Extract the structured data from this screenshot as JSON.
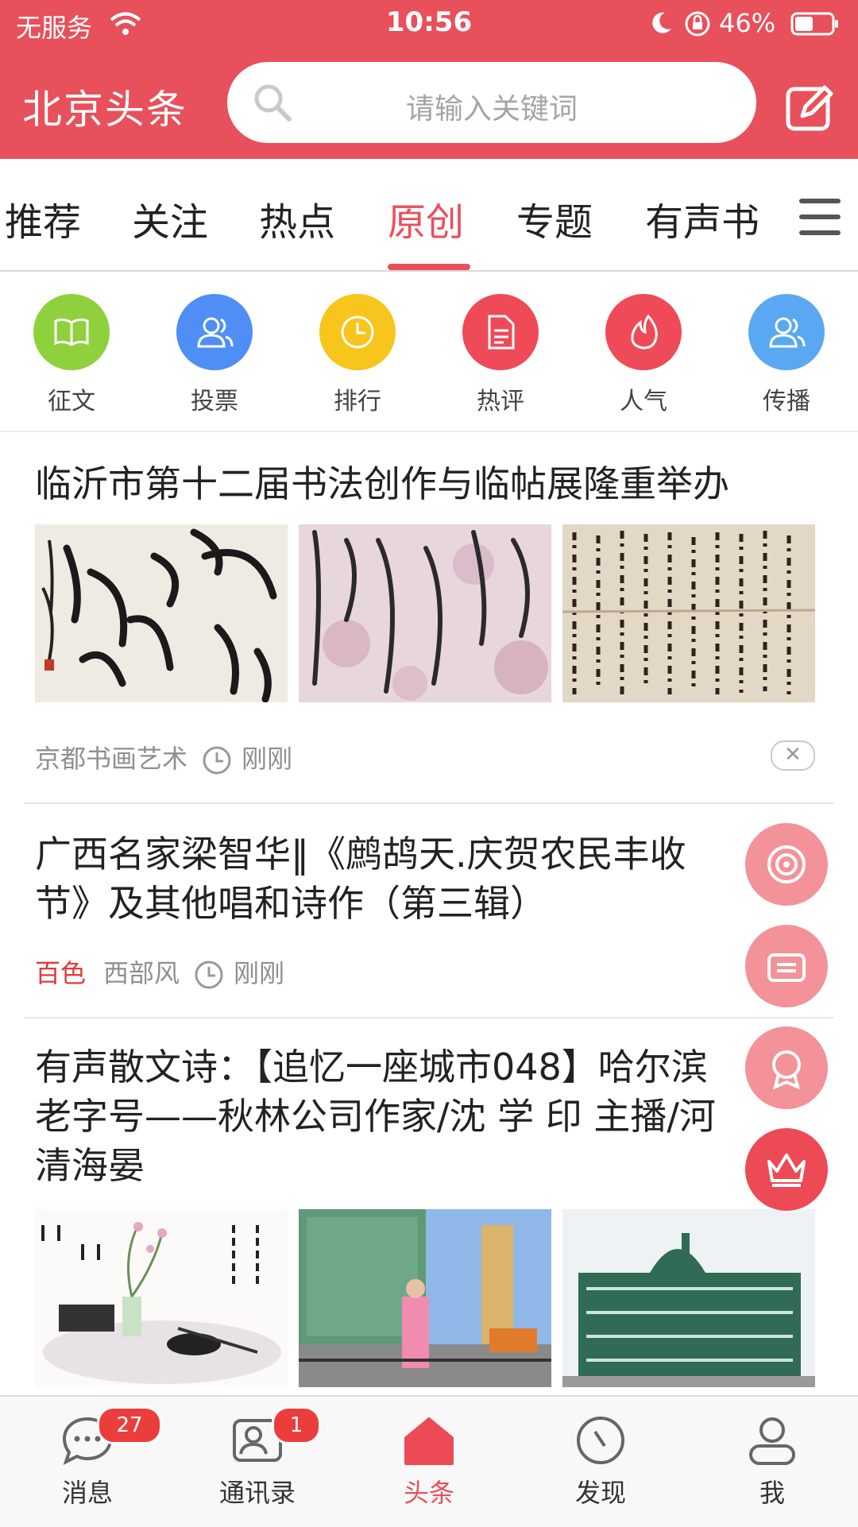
{
  "status_bar": {
    "carrier": "无服务",
    "time": "10:56",
    "battery": "46%"
  },
  "header": {
    "title": "北京头条",
    "search_placeholder": "请输入关键词"
  },
  "tabs": [
    {
      "label": "推荐"
    },
    {
      "label": "关注"
    },
    {
      "label": "热点"
    },
    {
      "label": "原创",
      "active": true
    },
    {
      "label": "专题"
    },
    {
      "label": "有声书"
    }
  ],
  "quick_links": [
    {
      "label": "征文",
      "color": "#8fd13c",
      "icon": "book-icon"
    },
    {
      "label": "投票",
      "color": "#4f8ef5",
      "icon": "users-icon"
    },
    {
      "label": "排行",
      "color": "#f7c51b",
      "icon": "clock-icon"
    },
    {
      "label": "热评",
      "color": "#ef4a57",
      "icon": "document-icon"
    },
    {
      "label": "人气",
      "color": "#ef4a57",
      "icon": "flame-icon"
    },
    {
      "label": "传播",
      "color": "#5aa8f2",
      "icon": "users-icon"
    }
  ],
  "feed": [
    {
      "title": "临沂市第十二届书法创作与临帖展隆重举办",
      "source": "京都书画艺术",
      "time": "刚刚"
    },
    {
      "title_line1": "广西名家梁智华‖《鹧鸪天.庆贺农民丰收",
      "title_line2": "节》及其他唱和诗作（第三辑）",
      "tag": "百色",
      "source": "西部风",
      "time": "刚刚"
    },
    {
      "title_line1": "有声散文诗：【追忆一座城市048】哈尔滨",
      "title_line2": "老字号——秋林公司作家/沈 学 印 主播/河",
      "title_line3": "清海晏"
    }
  ],
  "bottom_nav": [
    {
      "label": "消息",
      "badge": "27"
    },
    {
      "label": "通讯录",
      "badge": "1"
    },
    {
      "label": "头条",
      "active": true
    },
    {
      "label": "发现"
    },
    {
      "label": "我"
    }
  ],
  "colors": {
    "brand": "#e8505b",
    "accent_red": "#e03a3a"
  }
}
